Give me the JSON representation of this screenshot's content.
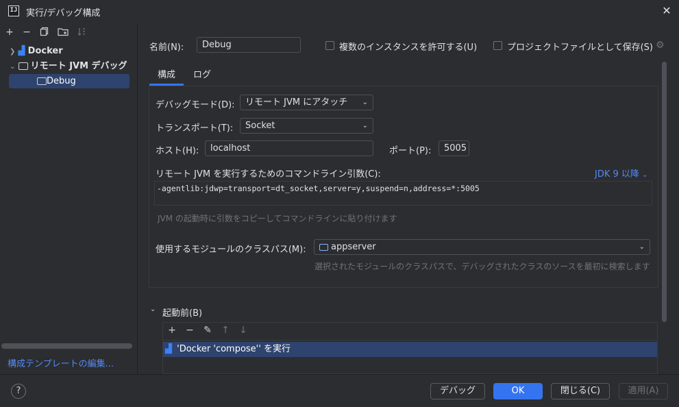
{
  "window": {
    "title": "実行/デバッグ構成"
  },
  "left": {
    "toolbar_icons": [
      "add-icon",
      "remove-icon",
      "copy-icon",
      "folder-icon",
      "sort-icon"
    ],
    "tree": [
      {
        "label": "Docker",
        "expanded": false
      },
      {
        "label": "リモート JVM デバッグ",
        "expanded": true
      },
      {
        "label": "Debug",
        "selected": true
      }
    ],
    "edit_templates_link": "構成テンプレートの編集..."
  },
  "form": {
    "name_label": "名前(N):",
    "name_value": "Debug",
    "allow_multiple_label": "複数のインスタンスを許可する(U)",
    "store_as_file_label": "プロジェクトファイルとして保存(S)",
    "tabs": [
      "構成",
      "ログ"
    ],
    "debugger_mode_label": "デバッグモード(D):",
    "debugger_mode_value": "リモート JVM にアタッチ",
    "transport_label": "トランスポート(T):",
    "transport_value": "Socket",
    "host_label": "ホスト(H):",
    "host_value": "localhost",
    "port_label": "ポート(P):",
    "port_value": "5005",
    "cmdline_label": "リモート JVM を実行するためのコマンドライン引数(C):",
    "jdk_link": "JDK 9 以降",
    "cmdline_value": "-agentlib:jdwp=transport=dt_socket,server=y,suspend=n,address=*:5005",
    "cmdline_hint": "JVM の起動時に引数をコピーしてコマンドラインに貼り付けます",
    "classpath_label": "使用するモジュールのクラスパス(M):",
    "classpath_value": "appserver",
    "classpath_hint": "選択されたモジュールのクラスパスで、デバッグされたクラスのソースを最初に検索します"
  },
  "before_launch": {
    "title": "起動前(B)",
    "toolbar_icons": [
      "add-icon",
      "remove-icon",
      "edit-icon",
      "move-up-icon",
      "move-down-icon"
    ],
    "items": [
      "'Docker 'compose'' を実行"
    ]
  },
  "footer": {
    "help": "?",
    "debug_button": "デバッグ",
    "ok_button": "OK",
    "close_button": "閉じる(C)",
    "apply_button": "適用(A)"
  },
  "colors": {
    "accent": "#3574f0",
    "selection": "#2e436e",
    "link": "#548af7",
    "background": "#2b2d30"
  }
}
